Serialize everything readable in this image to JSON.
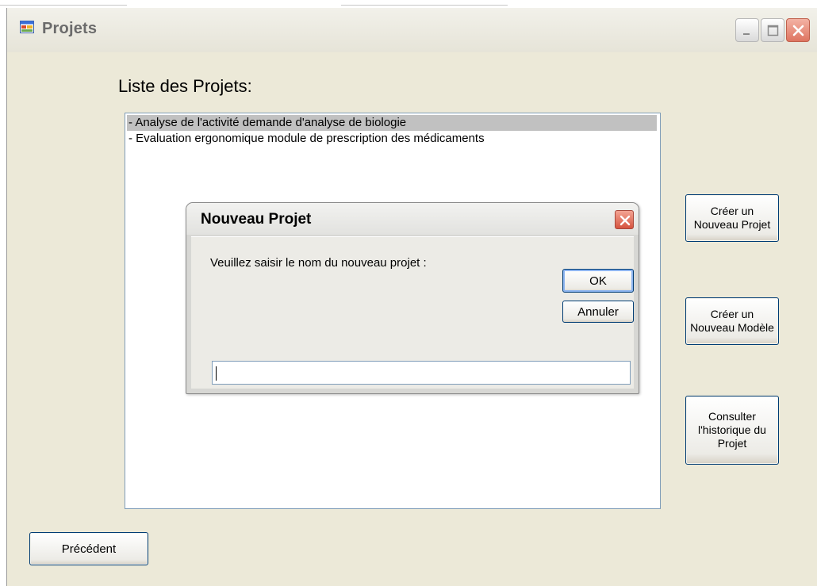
{
  "window": {
    "title": "Projets"
  },
  "main": {
    "list_label": "Liste des Projets:",
    "projects": [
      {
        "label": "- Analyse de l'activité demande d'analyse de biologie",
        "selected": true
      },
      {
        "label": "- Evaluation ergonomique module de prescription des médicaments",
        "selected": false
      }
    ]
  },
  "side_buttons": {
    "new_project": "Créer un\nNouveau Projet",
    "new_model": "Créer un\nNouveau Modèle",
    "history": "Consulter\nl'historique du\nProjet"
  },
  "footer": {
    "back_label": "Précédent"
  },
  "dialog": {
    "title": "Nouveau Projet",
    "prompt": "Veuillez saisir le nom du nouveau projet :",
    "ok_label": "OK",
    "cancel_label": "Annuler",
    "input_value": ""
  },
  "icons": {
    "app": "app-window-icon",
    "minimize": "minimize-icon",
    "maximize": "maximize-icon",
    "close": "close-icon"
  },
  "colors": {
    "window_bg": "#ece9d8",
    "selection": "#c1c1c1",
    "close_red": "#d5533f",
    "button_border": "#003c74"
  }
}
